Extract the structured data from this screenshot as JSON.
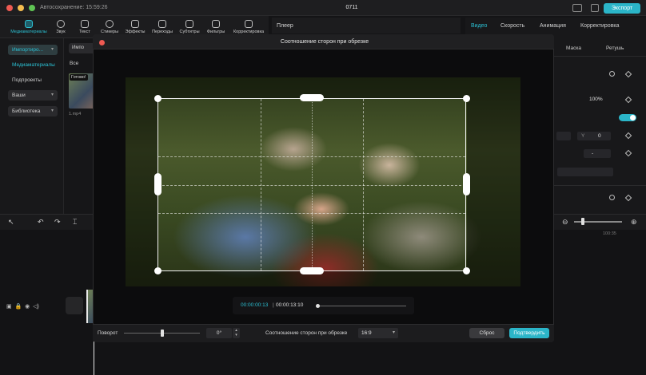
{
  "titlebar": {
    "autosave": "Автосохранение: 15:59:26",
    "project_title": "0711",
    "export_label": "Экспорт"
  },
  "toolbar": {
    "items": [
      {
        "label": "Медиаматериалы",
        "icon": "media-icon"
      },
      {
        "label": "Звук",
        "icon": "audio-icon"
      },
      {
        "label": "Текст",
        "icon": "text-icon"
      },
      {
        "label": "Стикеры",
        "icon": "sticker-icon"
      },
      {
        "label": "Эффекты",
        "icon": "effects-icon"
      },
      {
        "label": "Переходы",
        "icon": "transitions-icon"
      },
      {
        "label": "Субтитры",
        "icon": "subtitles-icon"
      },
      {
        "label": "Фильтры",
        "icon": "filters-icon"
      },
      {
        "label": "Корректировка",
        "icon": "adjust-icon"
      }
    ]
  },
  "sidebar": {
    "import_label": "Импортиро...",
    "items": [
      "Медиаматериалы",
      "Подпроекты"
    ],
    "dropdowns": [
      "Ваши",
      "Библиотека"
    ]
  },
  "media": {
    "import_label": "Импо",
    "filter_all": "Все",
    "ready_badge": "Готово!",
    "file_name": "1.mp4"
  },
  "player": {
    "title": "Плеер"
  },
  "right_panel": {
    "tabs": [
      "Видео",
      "Скорость",
      "Анимация",
      "Корректировка"
    ],
    "subtabs": [
      "Маска",
      "Ретушь"
    ],
    "scale_value": "100%",
    "y_label": "Y",
    "y_value": "0",
    "dash_value": "-"
  },
  "crop_dialog": {
    "title": "Соотношение сторон при обрезке",
    "current_time": "00:00:00:13",
    "time_separator": "|",
    "total_time": "00:00:13:10",
    "rotation_label": "Поворот",
    "rotation_value": "0°",
    "ratio_label": "Соотношение сторон при обрезке",
    "ratio_value": "16:9",
    "reset_label": "Сброс",
    "confirm_label": "Подтвердить"
  },
  "timeline": {
    "time_marker": "100:35"
  },
  "colors": {
    "accent": "#2bb5c8",
    "close": "#ee5a52",
    "minimize": "#f5bd4f",
    "maximize": "#5fc454"
  }
}
